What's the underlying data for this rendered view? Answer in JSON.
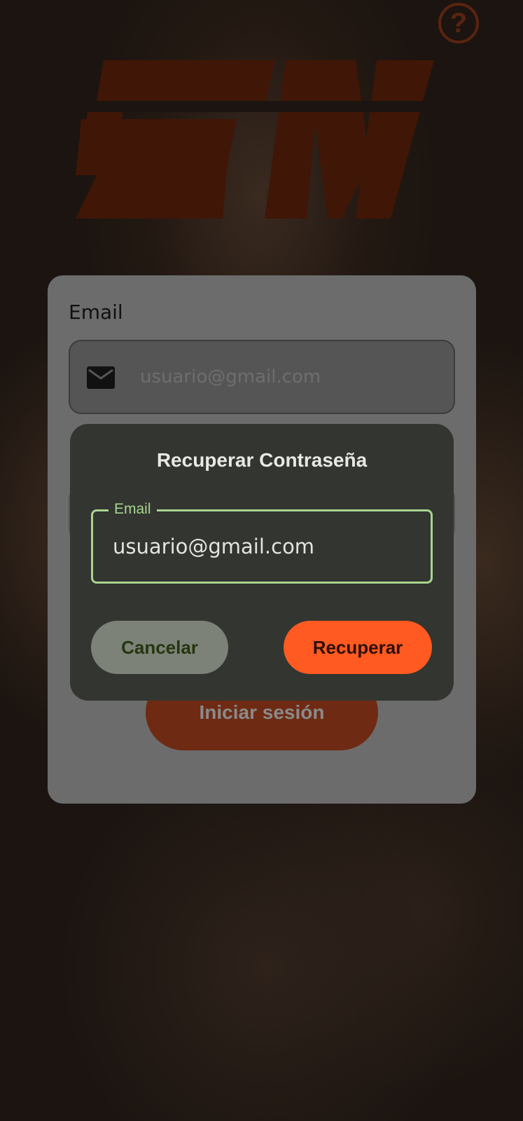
{
  "header": {
    "logo_text": "SM",
    "help_icon": "question-circle-icon",
    "help_glyph": "?"
  },
  "login_card": {
    "email_label": "Email",
    "email_placeholder": "usuario@gmail.com",
    "email_icon": "envelope-icon",
    "login_button": "Iniciar sesión"
  },
  "dialog": {
    "title": "Recuperar Contraseña",
    "email_field_label": "Email",
    "email_value": "usuario@gmail.com",
    "cancel_button": "Cancelar",
    "recover_button": "Recuperar"
  },
  "colors": {
    "accent": "#ff5a21",
    "field_focus": "#a8d490",
    "dialog_bg": "#323530"
  }
}
